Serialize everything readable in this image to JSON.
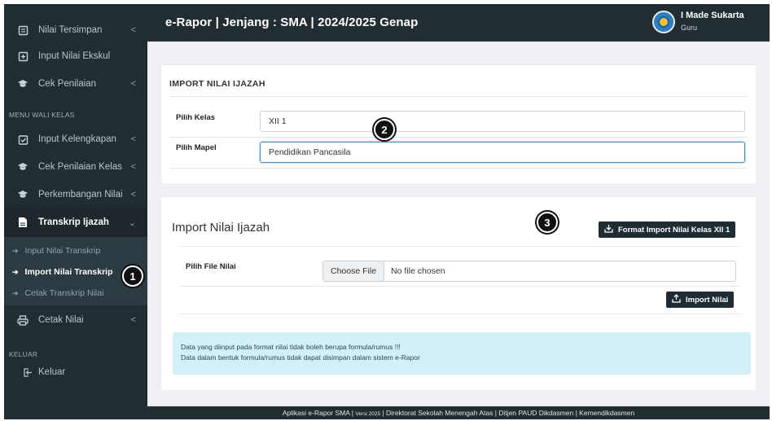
{
  "header": {
    "title": "e-Rapor | Jenjang : SMA | 2024/2025 Genap",
    "user_name": "I Made Sukarta",
    "user_role": "Guru"
  },
  "sidebar": {
    "items_top": [
      {
        "label": "Nilai Tersimpan",
        "icon": "document-icon",
        "chevron": "<"
      },
      {
        "label": "Input Nilai Ekskul",
        "icon": "plus-box-icon",
        "chevron": ""
      },
      {
        "label": "Cek Penilaian",
        "icon": "graduation-cap-icon",
        "chevron": "<"
      }
    ],
    "section_wali": "MENU WALI KELAS",
    "items_wali": [
      {
        "label": "Input Kelengkapan",
        "icon": "clipboard-check-icon",
        "chevron": "<"
      },
      {
        "label": "Cek Penilaian Kelas",
        "icon": "graduation-cap-icon",
        "chevron": "<"
      },
      {
        "label": "Perkembangan Nilai",
        "icon": "graduation-cap-icon",
        "chevron": "<"
      }
    ],
    "transkrip": {
      "label": "Transkrip Ijazah",
      "icon": "file-icon",
      "chevron": "⌄"
    },
    "submenu": [
      {
        "label": "Input Nilai Transkrip"
      },
      {
        "label": "Import Nilai Transkrip"
      },
      {
        "label": "Cetak Transkrip Nilai"
      }
    ],
    "cetak": {
      "label": "Cetak Nilai",
      "icon": "printer-icon",
      "chevron": "<"
    },
    "section_keluar": "KELUAR",
    "keluar": {
      "label": "Keluar",
      "icon": "logout-icon"
    }
  },
  "panel_import_ijazah": {
    "title": "IMPORT NILAI IJAZAH",
    "kelas_label": "Pilih Kelas",
    "kelas_value": "XII 1",
    "mapel_label": "Pilih Mapel",
    "mapel_value": "Pendidikan Pancasila"
  },
  "panel_import": {
    "title": "Import Nilai Ijazah",
    "format_button": "Format Import Nilai Kelas XII 1",
    "file_label": "Pilih File Nilai",
    "choose_file": "Choose File",
    "no_file": "No file chosen",
    "import_button": "Import Nilai",
    "alert_line1": "Data yang diinput pada format nilai tidak boleh berupa formula/rumus !!!",
    "alert_line2": "Data dalam bentuk formula/rumus tidak dapat disimpan dalam sistem e-Rapor"
  },
  "footer": {
    "part1": "Aplikasi e-Rapor SMA | ",
    "version": "Versi 2025",
    "part2": " | Direktorat Sekolah Menengah Atas | Ditjen PAUD Dikdasmen | Kemendikdasmen"
  },
  "badges": {
    "b1": "1",
    "b2": "2",
    "b3": "3"
  },
  "colors": {
    "sidebar_bg": "#222d32",
    "submenu_bg": "#2c3b41",
    "button_bg": "#1f2d33",
    "focus_border": "#3c8dbc",
    "alert_bg": "#d4f0f7"
  }
}
